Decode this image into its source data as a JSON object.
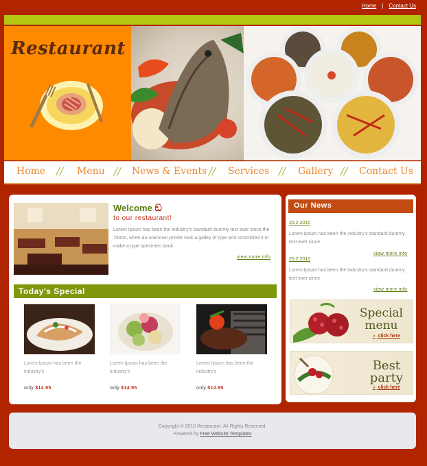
{
  "top_links": {
    "home": "Home",
    "separator": "|",
    "contact": "Contact Us"
  },
  "banner": {
    "logo_text": "Restaurant"
  },
  "nav": {
    "items": [
      "Home",
      "Menu",
      "News & Events",
      "Services",
      "Gallery",
      "Contact Us"
    ],
    "separator": "//"
  },
  "welcome": {
    "title": "Welcome",
    "glyph": "ඞ",
    "subtitle": "to our restaurant!",
    "body": "Lorem Ipsum has been the industry's standard dummy text ever since the 1500s, when an unknown printer took a galley of type and scrambled it to make a type specimen book.",
    "view_more": "view more info"
  },
  "special": {
    "title": "Today's Special",
    "items": [
      {
        "desc": "Lorem Ipsum has been the industry's",
        "price_prefix": "only",
        "price": "$14.95"
      },
      {
        "desc": "Lorem Ipsum has been the industry's",
        "price_prefix": "only",
        "price": "$14.95"
      },
      {
        "desc": "Lorem Ipsum has been the industry's",
        "price_prefix": "only",
        "price": "$14.95"
      }
    ]
  },
  "news": {
    "title": "Our News",
    "items": [
      {
        "date": "20.2.2010",
        "text": "Lorem Ipsum has been the industry's standard dummy text ever since",
        "view_more": "view more info"
      },
      {
        "date": "20.2.2010",
        "text": "Lorem Ipsum has been the industry's standard dummy text ever since",
        "view_more": "view more info"
      }
    ]
  },
  "promos": [
    {
      "line1": "Special",
      "line2": "menu",
      "link": "click here",
      "arrow": "»"
    },
    {
      "line1": "Best",
      "line2": "party",
      "link": "click here",
      "arrow": "»"
    }
  ],
  "footer": {
    "copyright": "Copyright © 2010 Restaurant. All Rights Reserved.",
    "powered_by": "Powered by",
    "powered_link": "Free Website Templates"
  },
  "colors": {
    "background": "#b02400",
    "accent_green": "#7f980c",
    "accent_orange": "#ff8a00",
    "news_header": "#c34b12",
    "price": "#c0331a"
  }
}
